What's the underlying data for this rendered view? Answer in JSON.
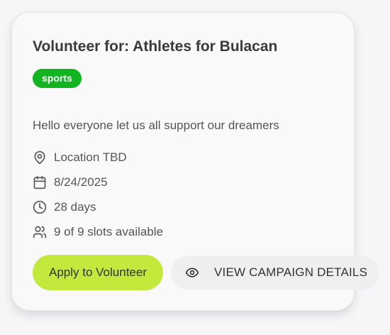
{
  "card": {
    "title": "Volunteer for: Athletes for Bulacan",
    "tag": "sports",
    "description": "Hello everyone let us all support our dreamers",
    "details": {
      "location": "Location TBD",
      "date": "8/24/2025",
      "duration": "28 days",
      "slots": "9 of 9 slots available"
    },
    "actions": {
      "apply_label": "Apply to Volunteer",
      "details_label": "VIEW CAMPAIGN DETAILS"
    }
  },
  "colors": {
    "tag_bg": "#12b521",
    "apply_bg": "#c3e93d",
    "details_bg": "#efefef"
  },
  "icons": {
    "location": "map-pin-icon",
    "date": "calendar-icon",
    "duration": "clock-icon",
    "slots": "users-icon",
    "details": "eye-icon"
  }
}
